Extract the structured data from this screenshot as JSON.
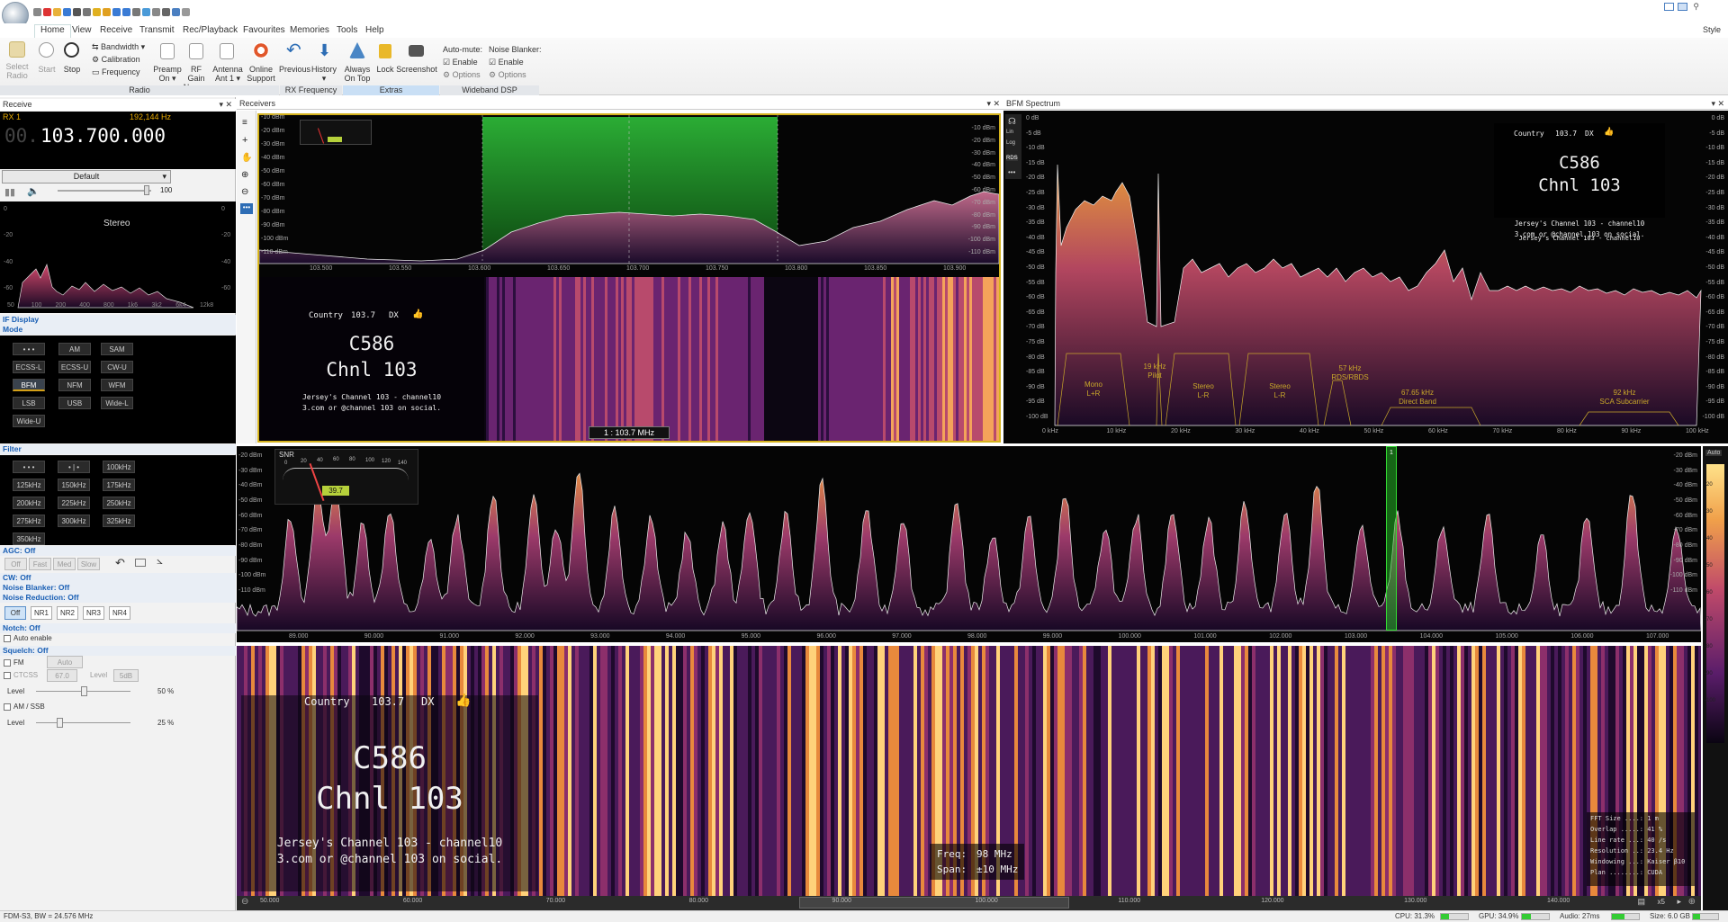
{
  "quick_access_icons": [
    "gear-icon",
    "record-icon",
    "folder-icon",
    "save-icon",
    "play-icon",
    "stop-icon",
    "star-icon",
    "lock-icon",
    "undo-icon",
    "redo-icon",
    "list-icon",
    "globe-icon",
    "search-icon",
    "arrow-icon",
    "screen-icon",
    "settings-icon"
  ],
  "menu": [
    "Home",
    "View",
    "Receive",
    "Transmit",
    "Rec/Playback",
    "Favourites",
    "Memories",
    "Tools",
    "Help"
  ],
  "style_label": "Style",
  "ribbon": {
    "select_radio": "Select Radio",
    "start": "Start",
    "stop": "Stop",
    "bandwidth": "Bandwidth",
    "calibration": "Calibration",
    "frequency": "Frequency",
    "preamp": "Preamp",
    "preamp_val": "On",
    "rf_gain": "RF Gain",
    "rf_gain_val": "None",
    "antenna": "Antenna",
    "antenna_val": "Ant 1",
    "online": "Online",
    "support": "Support",
    "previous": "Previous",
    "history": "History",
    "always": "Always",
    "on_top": "On Top",
    "lock": "Lock",
    "screenshot": "Screenshot",
    "auto_mute": "Auto-mute:",
    "noise_blanker": "Noise Blanker:",
    "enable": "Enable",
    "options": "Options",
    "groups": [
      "Radio",
      "RX Frequency",
      "Extras",
      "Wideband DSP"
    ]
  },
  "receive": {
    "title": "Receive",
    "rx": "RX 1",
    "rate": "192,144 Hz",
    "freq_prefix": "00.",
    "freq": "103.700.000",
    "profile": "Default",
    "volume": "100",
    "stereo": "Stereo",
    "audio_y": [
      "0",
      "-20",
      "-40",
      "-60"
    ],
    "audio_x": [
      "50",
      "100",
      "200",
      "400",
      "800",
      "1k6",
      "3k2",
      "6k4",
      "12k8"
    ]
  },
  "if_display": "IF Display",
  "mode": {
    "title": "Mode",
    "buttons": [
      "• • •",
      "AM",
      "SAM",
      "ECSS-L",
      "ECSS-U",
      "CW-U",
      "BFM",
      "NFM",
      "WFM",
      "LSB",
      "USB",
      "Wide-L",
      "Wide-U"
    ],
    "selected": "BFM"
  },
  "filter": {
    "title": "Filter",
    "buttons": [
      "• • •",
      "• | •",
      "100kHz",
      "125kHz",
      "150kHz",
      "175kHz",
      "200kHz",
      "225kHz",
      "250kHz",
      "275kHz",
      "300kHz",
      "325kHz",
      "350kHz"
    ]
  },
  "agc": {
    "title": "AGC: Off",
    "buttons": [
      "Off",
      "Fast",
      "Med",
      "Slow"
    ]
  },
  "cw": "CW: Off",
  "noise_blanker_title": "Noise Blanker: Off",
  "noise_reduction": {
    "title": "Noise Reduction: Off",
    "buttons": [
      "Off",
      "NR1",
      "NR2",
      "NR3",
      "NR4"
    ]
  },
  "notch": {
    "title": "Notch: Off",
    "auto_enable": "Auto enable"
  },
  "squelch": {
    "title": "Squelch: Off",
    "fm": "FM",
    "auto": "Auto",
    "ctcss": "CTCSS",
    "ctcss_val": "67.0",
    "level_label": "Level",
    "level_val": "5dB",
    "level": "Level",
    "level_pct": "50 %",
    "am_ssb": "AM / SSB",
    "level2": "Level",
    "level2_pct": "25 %",
    "level_fraction": 0.5,
    "level2_fraction": 0.25
  },
  "receivers": {
    "title": "Receivers",
    "dbm_left": [
      "-10 dBm",
      "-20 dBm",
      "-30 dBm",
      "-40 dBm",
      "-50 dBm",
      "-60 dBm",
      "-70 dBm",
      "-80 dBm",
      "-90 dBm",
      "-100 dBm",
      "-110 dBm"
    ],
    "dbm_right": [
      "-10 dBm",
      "-20 dBm",
      "-30 dBm",
      "-40 dBm",
      "-50 dBm",
      "-60 dBm",
      "-70 dBm",
      "-80 dBm",
      "-90 dBm",
      "-100 dBm",
      "-110 dBm"
    ],
    "freq_axis": [
      "103.500",
      "103.550",
      "103.600",
      "103.650",
      "103.700",
      "103.750",
      "103.800",
      "103.850",
      "103.900"
    ],
    "marker": "1 : 103.7 MHz"
  },
  "rds": {
    "line1": [
      "Country",
      "103.7",
      "DX"
    ],
    "ps1": "C586",
    "ps2": "Chnl 103",
    "rt1": "Jersey's Channel 103 - channel10",
    "rt2": "3.com or @channel 103 on social."
  },
  "bfm": {
    "title": "BFM Spectrum",
    "db_left": [
      "0 dB",
      "-5 dB",
      "-10 dB",
      "-15 dB",
      "-20 dB",
      "-25 dB",
      "-30 dB",
      "-35 dB",
      "-40 dB",
      "-45 dB",
      "-50 dB",
      "-55 dB",
      "-60 dB",
      "-65 dB",
      "-70 dB",
      "-75 dB",
      "-80 dB",
      "-85 dB",
      "-90 dB",
      "-95 dB",
      "-100 dB"
    ],
    "khz_axis": [
      "0 kHz",
      "10 kHz",
      "20 kHz",
      "30 kHz",
      "40 kHz",
      "50 kHz",
      "60 kHz",
      "70 kHz",
      "80 kHz",
      "90 kHz",
      "100 kHz"
    ],
    "side_buttons": [
      "Lin",
      "Log",
      "RDS"
    ],
    "bands": [
      {
        "l1": "Mono",
        "l2": "L+R"
      },
      {
        "l1": "19 kHz",
        "l2": "Pilot"
      },
      {
        "l1": "Stereo",
        "l2": "L-R"
      },
      {
        "l1": "Stereo",
        "l2": "L-R"
      },
      {
        "l1": "57 kHz",
        "l2": "RDS/RBDS"
      },
      {
        "l1": "67.65 kHz",
        "l2": "Direct Band"
      },
      {
        "l1": "92 kHz",
        "l2": "SCA Subcarrier"
      }
    ]
  },
  "wide": {
    "snr_label": "SNR",
    "snr_value": "39.7",
    "snr_scale": [
      "0",
      "20",
      "40",
      "60",
      "80",
      "100",
      "120",
      "140"
    ],
    "dbm": [
      "-20 dBm",
      "-30 dBm",
      "-40 dBm",
      "-50 dBm",
      "-60 dBm",
      "-70 dBm",
      "-80 dBm",
      "-90 dBm",
      "-100 dBm",
      "-110 dBm"
    ],
    "freq_axis": [
      "89.000",
      "90.000",
      "91.000",
      "92.000",
      "93.000",
      "94.000",
      "95.000",
      "96.000",
      "97.000",
      "98.000",
      "99.000",
      "100.000",
      "101.000",
      "102.000",
      "103.000",
      "104.000",
      "105.000",
      "106.000",
      "107.000"
    ],
    "auto": "Auto",
    "marker": "1",
    "color_scale": [
      "-20",
      "-30",
      "-40",
      "-50",
      "-60",
      "-70",
      "-80",
      "-90",
      "-100"
    ]
  },
  "waterfall": {
    "freq_label": "Freq:",
    "freq_val": "98 MHz",
    "span_label": "Span:",
    "span_val": "±10 MHz",
    "stats": [
      {
        "k": "FFT Size ....:",
        "v": "1 m"
      },
      {
        "k": "Overlap .....:",
        "v": "41 %"
      },
      {
        "k": "Line rate ...:",
        "v": "40 /s"
      },
      {
        "k": "Resolution ..:",
        "v": "23.4 Hz"
      },
      {
        "k": "Windowing ...:",
        "v": "Kaiser β10"
      },
      {
        "k": "Plan ........:",
        "v": "CUDA"
      }
    ],
    "freq_axis": [
      "50.000",
      "60.000",
      "70.000",
      "80.000",
      "90.000",
      "100.000",
      "110.000",
      "120.000",
      "130.000",
      "140.000"
    ],
    "zoom": "x5"
  },
  "status": {
    "device": "FDM-S3, BW = 24.576 MHz",
    "cpu": "CPU: 31.3%",
    "gpu": "GPU: 34.9%",
    "audio": "Audio: 27ms",
    "size": "Size: 6.0 GB",
    "cpu_fraction": 0.313,
    "gpu_fraction": 0.349,
    "audio_fraction": 0.45,
    "size_fraction": 0.3
  },
  "colors": {
    "accent": "#1a5fb4",
    "selection_green": "#1e9c1e",
    "waterfall_hot": "#ffd27a",
    "rds_bg": "#050505"
  }
}
